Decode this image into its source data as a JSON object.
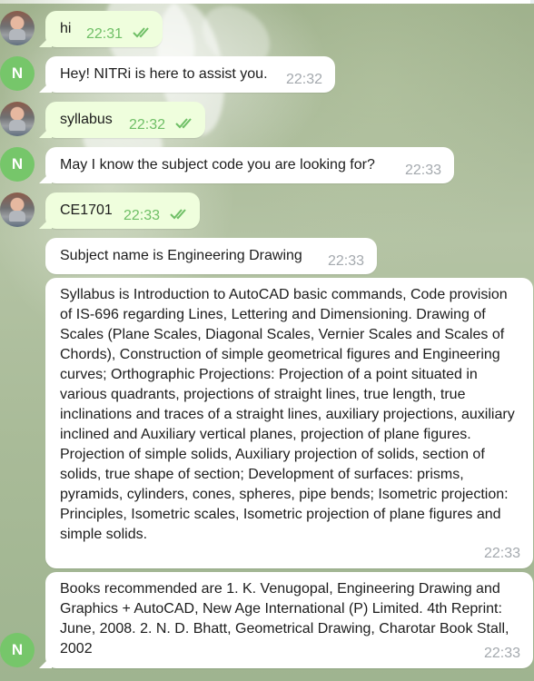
{
  "colors": {
    "incoming_bubble": "#ffffff",
    "outgoing_bubble": "#effedd",
    "outgoing_time": "#6fbf66",
    "incoming_time": "#a4a9ae",
    "bot_avatar": "#76c66a"
  },
  "bot_avatar_letter": "N",
  "messages": [
    {
      "sender": "user",
      "text": "hi",
      "time": "22:31",
      "status": "read"
    },
    {
      "sender": "bot",
      "text": "Hey! NITRi is here to assist you.",
      "time": "22:32"
    },
    {
      "sender": "user",
      "text": "syllabus",
      "time": "22:32",
      "status": "read"
    },
    {
      "sender": "bot",
      "text": "May I know the subject code you are looking for?",
      "time": "22:33"
    },
    {
      "sender": "user",
      "text": "CE1701",
      "time": "22:33",
      "status": "read"
    },
    {
      "sender": "bot",
      "text": "Subject name is Engineering Drawing",
      "time": "22:33"
    },
    {
      "sender": "bot",
      "text": "Syllabus is Introduction to AutoCAD basic commands, Code provision of IS-696 regarding Lines, Lettering and Dimensioning. Drawing of Scales (Plane Scales, Diagonal Scales, Vernier Scales and Scales of Chords), Construction of simple geometrical figures and Engineering curves; Orthographic Projections: Projection of a point situated in various quadrants, projections of straight lines, true length, true inclinations and traces of a straight lines, auxiliary projections, auxiliary inclined and Auxiliary vertical planes, projection of plane figures. Projection of simple solids, Auxiliary projection of solids, section of solids, true shape of section; Development of surfaces: prisms, pyramids, cylinders, cones, spheres, pipe bends; Isometric projection: Principles, Isometric scales, Isometric projection of plane figures and simple solids.",
      "time": "22:33"
    },
    {
      "sender": "bot",
      "text": "Books recommended are 1. K. Venugopal, Engineering Drawing and Graphics + AutoCAD, New Age International (P) Limited. 4th Reprint: June, 2008. 2. N. D. Bhatt, Geometrical Drawing, Charotar Book Stall, 2002",
      "time": "22:33"
    }
  ]
}
